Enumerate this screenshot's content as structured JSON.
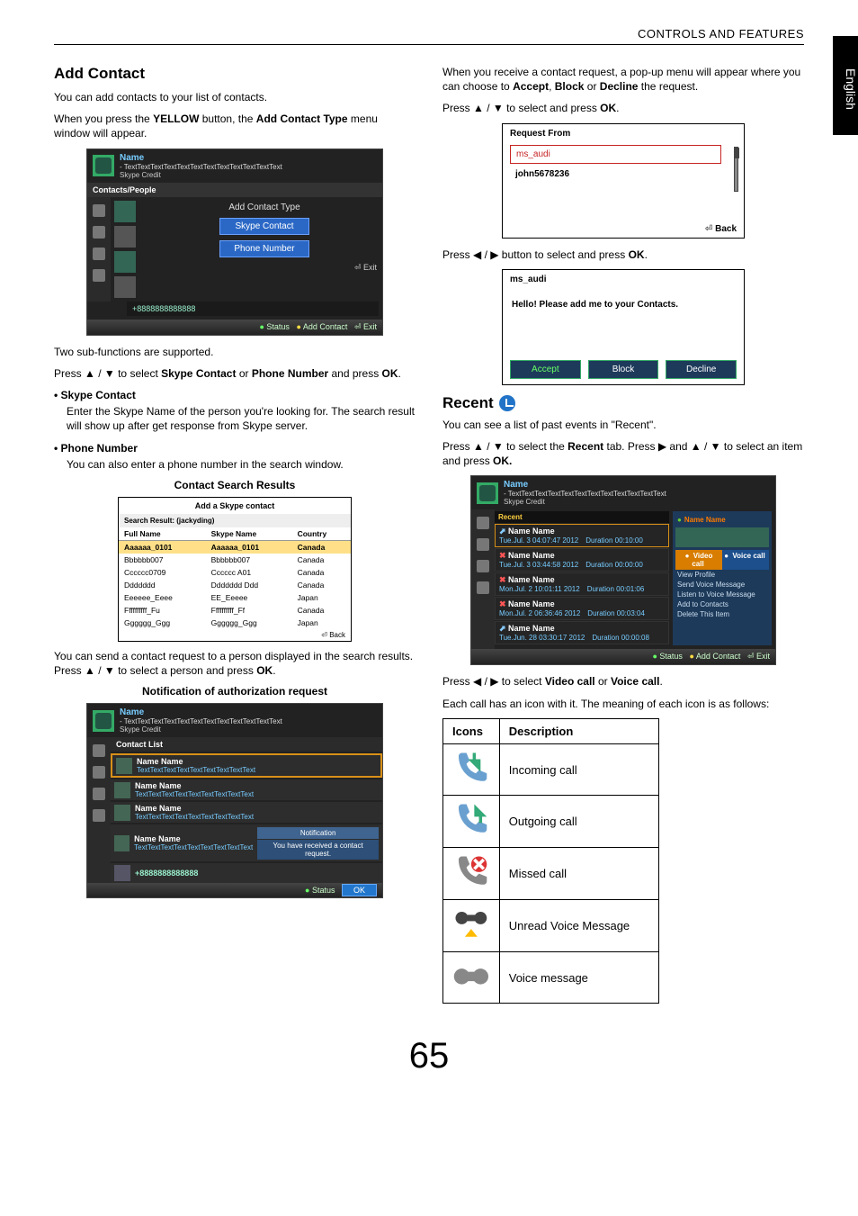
{
  "running_head": "CONTROLS AND FEATURES",
  "side_tab": "English",
  "page_number": "65",
  "left": {
    "h_add_contact": "Add Contact",
    "p_intro": "You can add contacts to your list of contacts.",
    "p_yellow_1": "When you press the ",
    "p_yellow_btn": "YELLOW",
    "p_yellow_2": " button, the ",
    "p_yellow_menu": "Add Contact Type",
    "p_yellow_3": " menu window will appear.",
    "fig1": {
      "name": "Name",
      "tagline": "- TextTextTextTextTextTextTextTextTextTextTextText",
      "credit": "Skype Credit",
      "tab": "Contacts/People",
      "center_title": "Add Contact Type",
      "btn_skype": "Skype Contact",
      "btn_phone": "Phone Number",
      "exit": "Exit",
      "phone": "+8888888888888",
      "footer_status": "Status",
      "footer_add": "Add Contact",
      "footer_exit": "Exit"
    },
    "p_two_sub": "Two sub-functions are supported.",
    "p_select_1": "Press ▲ / ▼ to select ",
    "p_select_sc": "Skype Contact",
    "p_select_or": " or ",
    "p_select_pn": "Phone Number",
    "p_select_2": " and press ",
    "p_select_ok": "OK",
    "p_select_3": ".",
    "b_skype": "Skype Contact",
    "b_skype_p": "Enter the Skype Name of the person you're looking for. The search result will show up after get response from Skype server.",
    "b_phone": "Phone Number",
    "b_phone_p": "You can also enter a phone number in the search window.",
    "cap_results": "Contact Search Results",
    "fig_results": {
      "title": "Add a Skype contact",
      "sub": "Search Result: (jackyding)",
      "col_full": "Full Name",
      "col_skype": "Skype Name",
      "col_country": "Country",
      "rows": [
        {
          "full": "Aaaaaa_0101",
          "skype": "Aaaaaa_0101",
          "country": "Canada"
        },
        {
          "full": "Bbbbbb007",
          "skype": "Bbbbbb007",
          "country": "Canada"
        },
        {
          "full": "Cccccc0709",
          "skype": "Cccccc A01",
          "country": "Canada"
        },
        {
          "full": "Ddddddd",
          "skype": "Ddddddd Ddd",
          "country": "Canada"
        },
        {
          "full": "Eeeeee_Eeee",
          "skype": "EE_Eeeee",
          "country": "Japan"
        },
        {
          "full": "Ffffffffff_Fu",
          "skype": "Ffffffffff_Ff",
          "country": "Canada"
        },
        {
          "full": "Gggggg_Ggg",
          "skype": "Gggggg_Ggg",
          "country": "Japan"
        }
      ],
      "back": "Back"
    },
    "p_send_req_1": "You can send a contact request to a person displayed in the search results. Press ▲ / ▼ to select a person and press ",
    "p_send_req_ok": "OK",
    "p_send_req_2": ".",
    "cap_notif": "Notification of authorization request",
    "fig_cl": {
      "header": "Contact List",
      "name": "Name",
      "tagline": "- TextTextTextTextTextTextTextTextTextTextTextText",
      "credit": "Skype Credit",
      "rows": [
        {
          "nm": "Name Name",
          "tx": "TextTextTextTextTextTextTextTextText"
        },
        {
          "nm": "Name Name",
          "tx": "TextTextTextTextTextTextTextTextText"
        },
        {
          "nm": "Name Name",
          "tx": "TextTextTextTextTextTextTextTextText"
        },
        {
          "nm": "Name Name",
          "tx": "TextTextTextTextTextTextTextTextText"
        }
      ],
      "phone": "+8888888888888",
      "notif_t": "Notification",
      "notif_b": "You have received a contact request.",
      "footer_status": "Status",
      "footer_ok": "OK"
    }
  },
  "right": {
    "p_receive_1": "When you receive a contact request, a pop-up menu will appear where you can choose to ",
    "w_accept": "Accept",
    "w_sep1": ", ",
    "w_block": "Block",
    "w_sep2": " or ",
    "w_decline": "Decline",
    "p_receive_2": " the request.",
    "p_updown": "Press ▲ / ▼ to select and press ",
    "p_updown_ok": "OK",
    "p_updown_end": ".",
    "fig_req": {
      "title": "Request From",
      "row1": "ms_audi",
      "row2": "john5678236",
      "back": "Back"
    },
    "p_leftright": "Press ◀ / ▶ button to select and press ",
    "p_leftright_ok": "OK",
    "p_leftright_end": ".",
    "fig_msg": {
      "title": "ms_audi",
      "msg": "Hello! Please add me to your Contacts.",
      "accept": "Accept",
      "block": "Block",
      "decline": "Decline"
    },
    "h_recent": "Recent",
    "p_recent1": "You can see a list of past events in \"Recent\".",
    "p_recent2_a": "Press ▲ / ▼ to select the ",
    "p_recent2_b": "Recent",
    "p_recent2_c": " tab. Press ▶ and ▲ / ▼ to select an item and press ",
    "p_recent2_ok": "OK.",
    "fig_recent": {
      "name": "Name",
      "tagline": "- TextTextTextTextTextTextTextTextTextTextTextText",
      "credit": "Skype Credit",
      "tab": "Recent",
      "popup_name": "Name Name",
      "video": "Video call",
      "voice": "Voice call",
      "menu": [
        "View Profile",
        "Send Voice Message",
        "Listen to Voice Message",
        "Add to Contacts",
        "Delete This Item"
      ],
      "items": [
        {
          "nm": "Name Name",
          "date": "Tue.Jul. 3  04:07:47 2012",
          "dur": "Duration  00:10:00"
        },
        {
          "nm": "Name Name",
          "date": "Tue.Jul. 3  03:44:58 2012",
          "dur": "Duration  00:00:00"
        },
        {
          "nm": "Name Name",
          "date": "Mon.Jul. 2  10:01:11 2012",
          "dur": "Duration  00:01:06"
        },
        {
          "nm": "Name Name",
          "date": "Mon.Jul. 2  06:36:46 2012",
          "dur": "Duration  00:03:04"
        },
        {
          "nm": "Name Name",
          "date": "Tue.Jun. 28  03:30:17 2012",
          "dur": "Duration  00:00:08"
        }
      ],
      "footer_status": "Status",
      "footer_add": "Add Contact",
      "footer_exit": "Exit"
    },
    "p_vv_1": "Press ◀ / ▶ to select ",
    "p_vv_video": "Video call",
    "p_vv_or": " or ",
    "p_vv_voice": "Voice call",
    "p_vv_2": ".",
    "p_each": "Each call has an icon with it. The meaning of each icon is as follows:",
    "tbl": {
      "h_icons": "Icons",
      "h_desc": "Description",
      "rows": [
        "Incoming call",
        "Outgoing call",
        "Missed call",
        "Unread Voice Message",
        "Voice message"
      ]
    }
  }
}
